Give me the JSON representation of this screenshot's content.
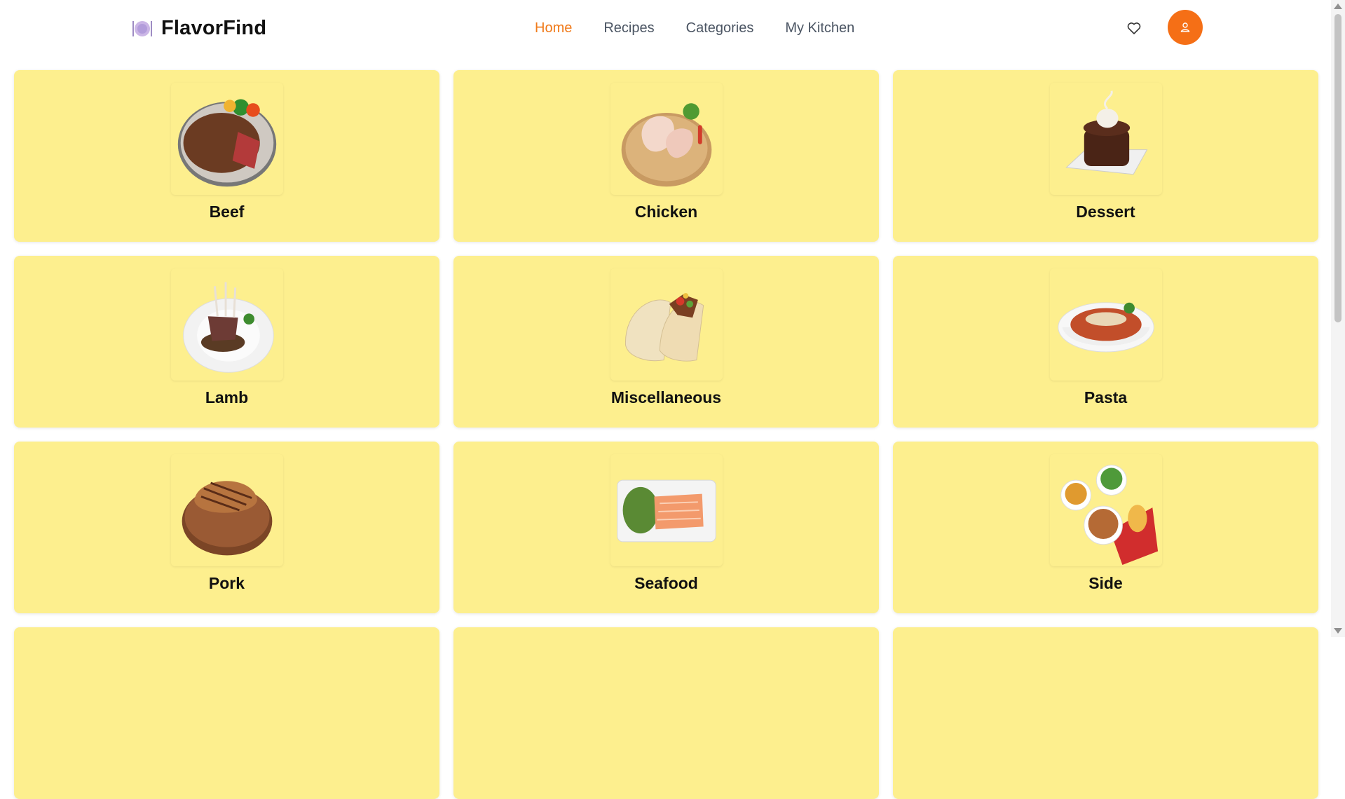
{
  "app": {
    "name": "FlavorFind",
    "logo_icon": "plate-cutlery-icon"
  },
  "nav": {
    "items": [
      {
        "label": "Home",
        "active": true
      },
      {
        "label": "Recipes",
        "active": false
      },
      {
        "label": "Categories",
        "active": false
      },
      {
        "label": "My Kitchen",
        "active": false
      }
    ]
  },
  "header_actions": {
    "favorites_icon": "heart-icon",
    "profile_icon": "user-icon"
  },
  "colors": {
    "accent": "#f07a1a",
    "avatar_bg": "#f56f16",
    "card_bg": "#fdef8e",
    "text": "#111111"
  },
  "categories": [
    {
      "label": "Beef",
      "image": "beef-steak-image"
    },
    {
      "label": "Chicken",
      "image": "chicken-image"
    },
    {
      "label": "Dessert",
      "image": "dessert-image"
    },
    {
      "label": "Lamb",
      "image": "lamb-image"
    },
    {
      "label": "Miscellaneous",
      "image": "tacos-image"
    },
    {
      "label": "Pasta",
      "image": "pasta-image"
    },
    {
      "label": "Pork",
      "image": "pork-image"
    },
    {
      "label": "Seafood",
      "image": "seafood-image"
    },
    {
      "label": "Side",
      "image": "side-dishes-image"
    }
  ]
}
